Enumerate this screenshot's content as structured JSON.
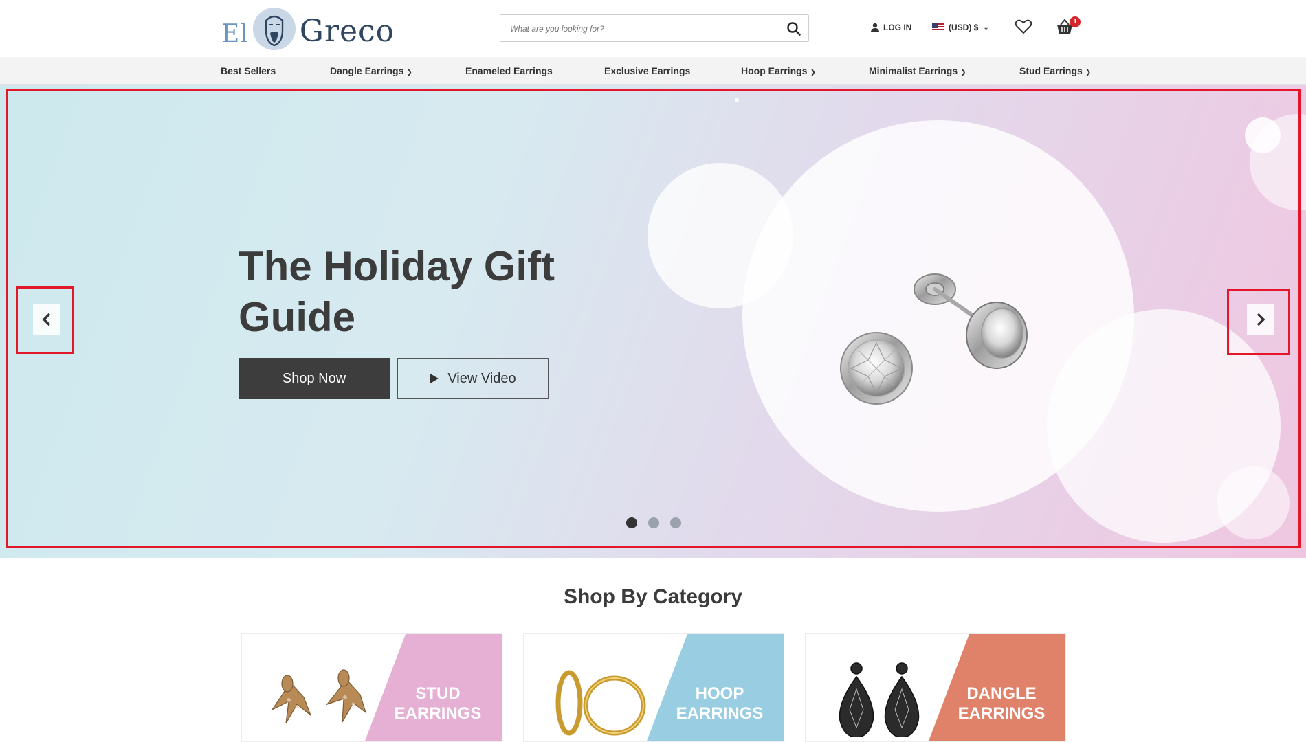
{
  "brand": {
    "word1": "El",
    "word2": "Greco"
  },
  "search": {
    "placeholder": "What are you looking for?"
  },
  "header": {
    "login_label": "LOG IN",
    "currency_label": "(USD) $",
    "cart_count": "1"
  },
  "nav": {
    "items": [
      {
        "label": "Best Sellers",
        "has_dropdown": false
      },
      {
        "label": "Dangle Earrings",
        "has_dropdown": true
      },
      {
        "label": "Enameled Earrings",
        "has_dropdown": false
      },
      {
        "label": "Exclusive Earrings",
        "has_dropdown": false
      },
      {
        "label": "Hoop Earrings",
        "has_dropdown": true
      },
      {
        "label": "Minimalist Earrings",
        "has_dropdown": true
      },
      {
        "label": "Stud Earrings",
        "has_dropdown": true
      }
    ]
  },
  "hero": {
    "title": "The Holiday Gift Guide",
    "shop_button": "Shop Now",
    "video_button": "View Video",
    "slide_count": 3,
    "active_slide": 1
  },
  "categories": {
    "title": "Shop By Category",
    "items": [
      {
        "label_line1": "STUD",
        "label_line2": "EARRINGS",
        "color": "#e6afd4"
      },
      {
        "label_line1": "HOOP",
        "label_line2": "EARRINGS",
        "color": "#98cde2"
      },
      {
        "label_line1": "DANGLE",
        "label_line2": "EARRINGS",
        "color": "#e0826a"
      }
    ]
  },
  "colors": {
    "accent_dark": "#3d3d3d",
    "badge_red": "#d6262c",
    "highlight_red": "#e3162a"
  }
}
